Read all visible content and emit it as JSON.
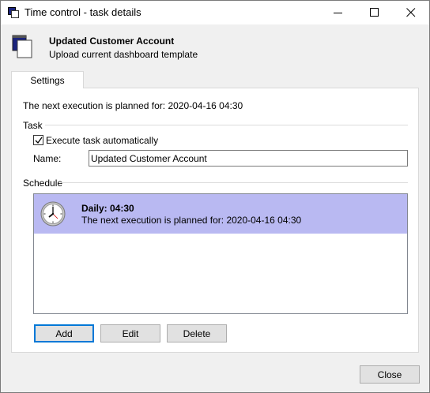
{
  "window": {
    "title": "Time control - task details"
  },
  "header": {
    "task_title": "Updated Customer Account",
    "task_subtitle": "Upload current dashboard template"
  },
  "tabs": [
    {
      "label": "Settings",
      "selected": true
    }
  ],
  "settings": {
    "next_execution": "The next execution is planned for: 2020-04-16 04:30",
    "task_group_label": "Task",
    "execute_auto_label": "Execute task automatically",
    "execute_auto_checked": true,
    "name_label": "Name:",
    "name_value": "Updated Customer Account",
    "schedule_group_label": "Schedule",
    "schedule_items": [
      {
        "title": "Daily: 04:30",
        "next": "The next execution is planned for: 2020-04-16 04:30",
        "icon": "clock-icon",
        "selected": true
      }
    ]
  },
  "buttons": {
    "add": "Add",
    "edit": "Edit",
    "delete": "Delete",
    "close": "Close"
  },
  "colors": {
    "selection": "#b9b9f2",
    "focus_border": "#0078d7"
  }
}
